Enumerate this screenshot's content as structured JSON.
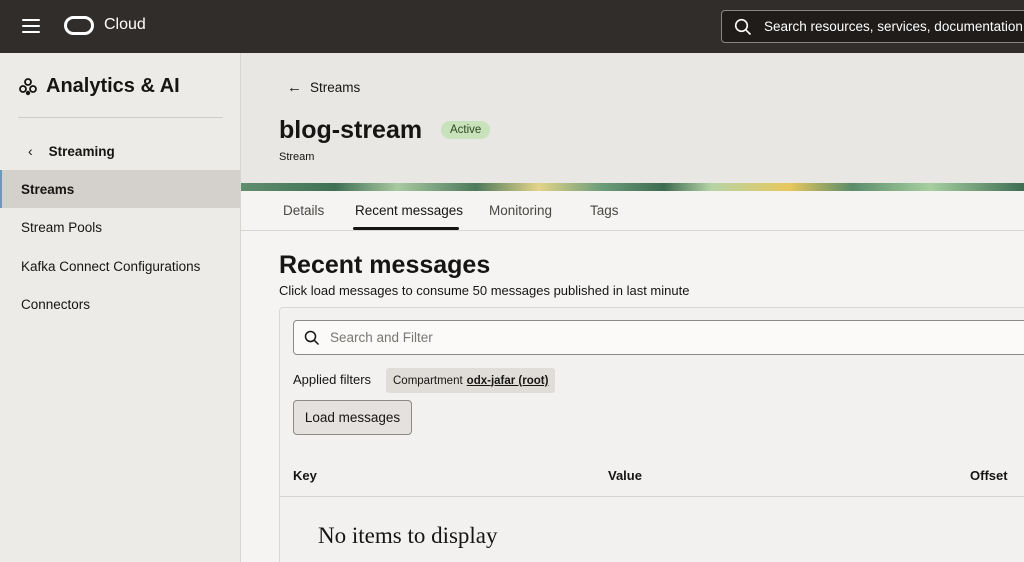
{
  "topbar": {
    "brand": "Cloud",
    "search_placeholder": "Search resources, services, documentation, and Marketplace"
  },
  "sidebar": {
    "heading": "Analytics & AI",
    "back_label": "Streaming",
    "items": [
      {
        "label": "Streams",
        "active": true
      },
      {
        "label": "Stream Pools",
        "active": false
      },
      {
        "label": "Kafka Connect Configurations",
        "active": false
      },
      {
        "label": "Connectors",
        "active": false
      }
    ]
  },
  "page": {
    "back_label": "Streams",
    "title": "blog-stream",
    "status": "Active",
    "subtitle": "Stream",
    "tabs": [
      {
        "label": "Details"
      },
      {
        "label": "Recent messages",
        "active": true
      },
      {
        "label": "Monitoring"
      },
      {
        "label": "Tags"
      }
    ]
  },
  "messages": {
    "title": "Recent messages",
    "description": "Click load messages to consume 50 messages published in last minute",
    "filter_placeholder": "Search and Filter",
    "applied_filters_label": "Applied filters",
    "filter_chip": {
      "key": "Compartment",
      "value": "odx-jafar (root)"
    },
    "load_button": "Load messages",
    "columns": [
      "Key",
      "Value",
      "Offset"
    ],
    "empty_text": "No items to display"
  },
  "colors": {
    "topbar": "#312d2a",
    "badge_active": "#c8e2bc",
    "sidebar_active": "#d4d1cd"
  }
}
